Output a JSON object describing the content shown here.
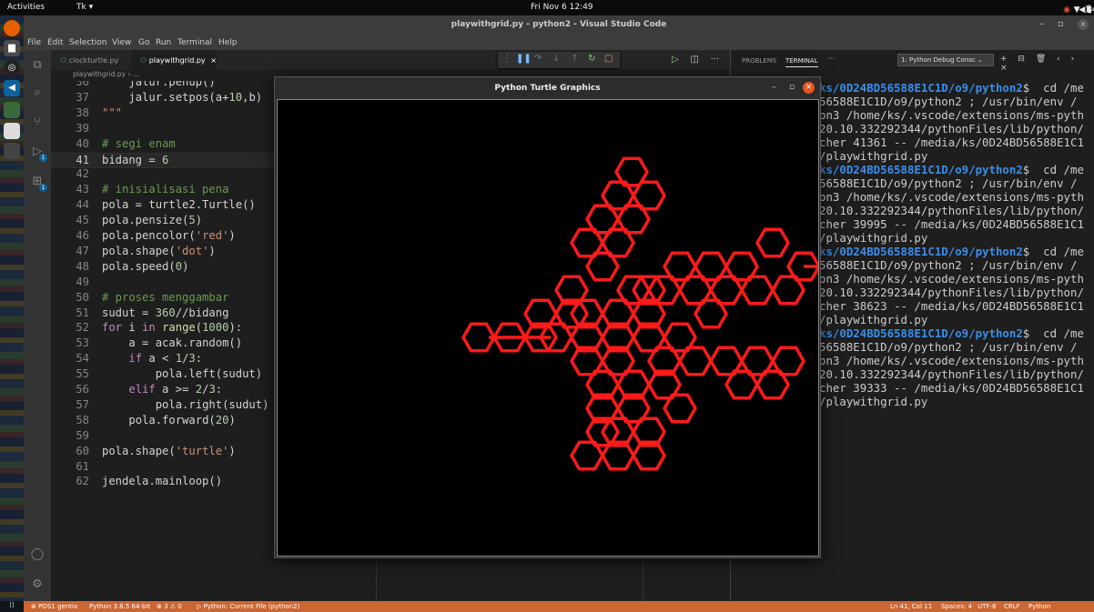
{
  "gnome": {
    "activities": "Activities",
    "app_menu": "Tk ▾",
    "clock": "Fri Nov 6  12:49",
    "battery": "84 %"
  },
  "vscode": {
    "title": "playwithgrid.py - python2 - Visual Studio Code",
    "menu": [
      "File",
      "Edit",
      "Selection",
      "View",
      "Go",
      "Run",
      "Terminal",
      "Help"
    ],
    "tabs": [
      {
        "label": "clockturtle.py",
        "active": false
      },
      {
        "label": "playwithgrid.py",
        "active": true,
        "close": "×"
      }
    ],
    "breadcrumb": "playwithgrid.py › ...",
    "code": [
      {
        "n": "36",
        "html": "    <span class='d'>jalur.penup()</span>"
      },
      {
        "n": "37",
        "html": "    <span class='d'>jalur.setpos(a+</span><span class='n'>10</span><span class='d'>,b)</span>"
      },
      {
        "n": "38",
        "html": "<span class='s'>\"\"\"</span>"
      },
      {
        "n": "39",
        "html": ""
      },
      {
        "n": "40",
        "html": "<span class='c'># segi enam</span>"
      },
      {
        "n": "41",
        "html": "<span class='d'>bidang = </span><span class='n'>6</span>",
        "current": true
      },
      {
        "n": "42",
        "html": ""
      },
      {
        "n": "43",
        "html": "<span class='c'># inisialisasi pena</span>"
      },
      {
        "n": "44",
        "html": "<span class='d'>pola = turtle2.Turtle()</span>"
      },
      {
        "n": "45",
        "html": "<span class='d'>pola.pensize(</span><span class='n'>5</span><span class='d'>)</span>"
      },
      {
        "n": "46",
        "html": "<span class='d'>pola.pencolor(</span><span class='s'>'red'</span><span class='d'>)</span>"
      },
      {
        "n": "47",
        "html": "<span class='d'>pola.shape(</span><span class='s'>'dot'</span><span class='d'>)</span>"
      },
      {
        "n": "48",
        "html": "<span class='d'>pola.speed(</span><span class='n'>0</span><span class='d'>)</span>"
      },
      {
        "n": "49",
        "html": ""
      },
      {
        "n": "50",
        "html": "<span class='c'># proses menggambar</span>"
      },
      {
        "n": "51",
        "html": "<span class='d'>sudut = </span><span class='n'>360</span><span class='d'>//bidang</span>"
      },
      {
        "n": "52",
        "html": "<span class='k'>for</span><span class='d'> i </span><span class='k'>in</span><span class='d'> </span><span class='f'>range</span><span class='d'>(</span><span class='n'>1000</span><span class='d'>):</span>"
      },
      {
        "n": "53",
        "html": "    <span class='d'>a = acak.random()</span>"
      },
      {
        "n": "54",
        "html": "    <span class='k'>if</span><span class='d'> a &lt; </span><span class='n'>1</span><span class='d'>/</span><span class='n'>3</span><span class='d'>:</span>"
      },
      {
        "n": "55",
        "html": "        <span class='d'>pola.left(sudut)</span>"
      },
      {
        "n": "56",
        "html": "    <span class='k'>elif</span><span class='d'> a &gt;= </span><span class='n'>2</span><span class='d'>/</span><span class='n'>3</span><span class='d'>:</span>"
      },
      {
        "n": "57",
        "html": "        <span class='d'>pola.right(sudut)</span>"
      },
      {
        "n": "58",
        "html": "    <span class='d'>pola.forward(</span><span class='n'>20</span><span class='d'>)</span>"
      },
      {
        "n": "59",
        "html": ""
      },
      {
        "n": "60",
        "html": "<span class='d'>pola.shape(</span><span class='s'>'turtle'</span><span class='d'>)</span>"
      },
      {
        "n": "61",
        "html": ""
      },
      {
        "n": "62",
        "html": "<span class='d'>jendela.mainloop()</span>"
      }
    ],
    "panel": {
      "tab_problems": "PROBLEMS",
      "tab_terminal": "TERMINAL",
      "more": "···",
      "terminal_select": "1: Python Debug Consc ⌄"
    },
    "terminal_lines": [
      {
        "prompt": "ks/0D24BD56588E1C1D/o9/python2",
        "rest": "$  cd /me"
      },
      {
        "text": "56588E1C1D/o9/python2 ; /usr/bin/env /"
      },
      {
        "text": "on3 /home/ks/.vscode/extensions/ms-pyth"
      },
      {
        "text": "20.10.332292344/pythonFiles/lib/python/"
      },
      {
        "text": "cher 41361 -- /media/ks/0D24BD56588E1C1"
      },
      {
        "text": "/playwithgrid.py"
      },
      {
        "prompt": "ks/0D24BD56588E1C1D/o9/python2",
        "rest": "$  cd /me"
      },
      {
        "text": "56588E1C1D/o9/python2 ; /usr/bin/env /"
      },
      {
        "text": "on3 /home/ks/.vscode/extensions/ms-pyth"
      },
      {
        "text": "20.10.332292344/pythonFiles/lib/python/"
      },
      {
        "text": "cher 39995 -- /media/ks/0D24BD56588E1C1"
      },
      {
        "text": "/playwithgrid.py"
      },
      {
        "prompt": "ks/0D24BD56588E1C1D/o9/python2",
        "rest": "$  cd /me"
      },
      {
        "text": "56588E1C1D/o9/python2 ; /usr/bin/env /"
      },
      {
        "text": "on3 /home/ks/.vscode/extensions/ms-pyth"
      },
      {
        "text": "20.10.332292344/pythonFiles/lib/python/"
      },
      {
        "text": "cher 38623 -- /media/ks/0D24BD56588E1C1"
      },
      {
        "text": "/playwithgrid.py"
      },
      {
        "prompt": "ks/0D24BD56588E1C1D/o9/python2",
        "rest": "$  cd /me"
      },
      {
        "text": "56588E1C1D/o9/python2 ; /usr/bin/env /"
      },
      {
        "text": "on3 /home/ks/.vscode/extensions/ms-pyth"
      },
      {
        "text": "20.10.332292344/pythonFiles/lib/python/"
      },
      {
        "text": "cher 39333 -- /media/ks/0D24BD56588E1C1"
      },
      {
        "text": "/playwithgrid.py"
      }
    ],
    "statusbar": {
      "remote": "⊗ POS1 gentia",
      "python": "Python 3.8.5 64-bit",
      "problems": "⊗ 3 ⚠ 0",
      "debug": "▷ Python: Current File (python2)",
      "position": "Ln 41, Col 11",
      "spaces": "Spaces: 4",
      "encoding": "UTF-8",
      "eol": "CRLF",
      "language": "Python"
    }
  },
  "turtle_window": {
    "title": "Python Turtle Graphics",
    "minimize": "–",
    "maximize": "▫",
    "close": "×",
    "pen_color": "#ff1a1a",
    "background": "#000000"
  },
  "colors": {
    "statusbar": "#cc6633",
    "prompt": "#3b8eea"
  }
}
